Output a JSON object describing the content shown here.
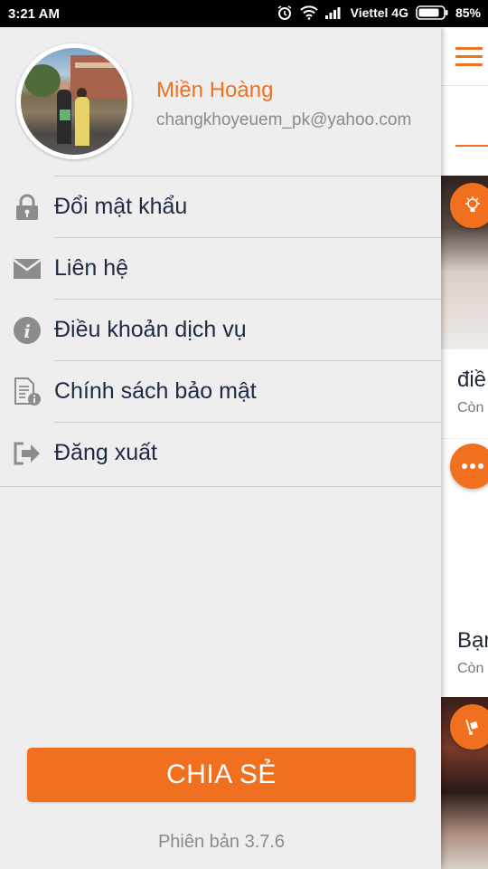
{
  "status_bar": {
    "time": "3:21 AM",
    "carrier": "Viettel 4G",
    "battery_percent": "85%",
    "icons": [
      "alarm-icon",
      "wifi-icon",
      "signal-icon",
      "battery-icon"
    ]
  },
  "profile": {
    "name": "Miền Hoàng",
    "email": "changkhoyeuem_pk@yahoo.com"
  },
  "menu": {
    "items": [
      {
        "label": "Đổi mật khẩu",
        "icon": "lock-icon"
      },
      {
        "label": "Liên hệ",
        "icon": "mail-icon"
      },
      {
        "label": "Điều khoản dịch vụ",
        "icon": "info-icon"
      },
      {
        "label": "Chính sách bảo mật",
        "icon": "document-info-icon"
      },
      {
        "label": "Đăng xuất",
        "icon": "logout-icon"
      }
    ]
  },
  "share_label": "CHIA SẺ",
  "version": "Phiên bản 3.7.6",
  "background_app": {
    "card1_title": "điề",
    "card1_sub": "Còn",
    "card2_title": "Bạn",
    "card2_sub": "Còn"
  },
  "colors": {
    "accent": "#f07020",
    "drawer_bg": "#eeeeee",
    "menu_text": "#1d2a44",
    "muted_text": "#8a8a8a"
  }
}
